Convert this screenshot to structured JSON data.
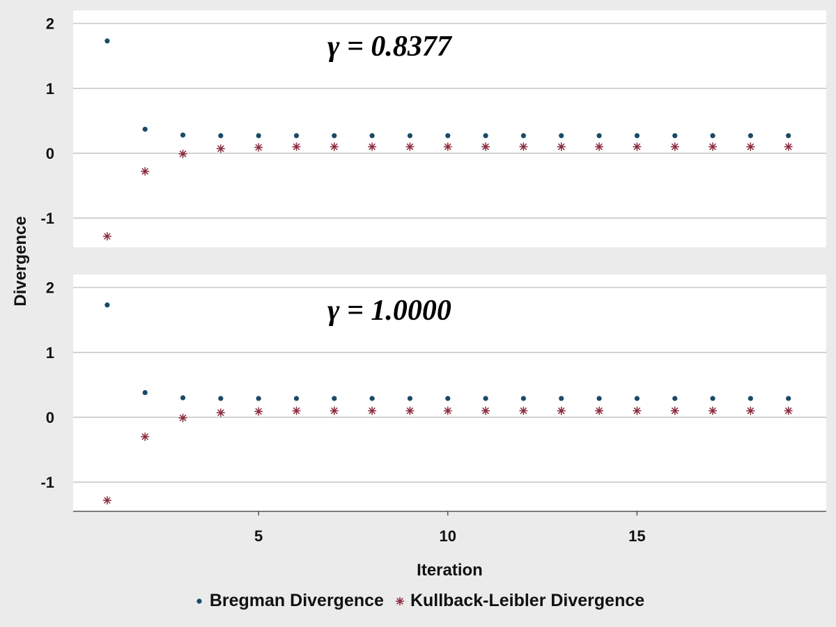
{
  "chart_data": {
    "type": "scatter",
    "xlabel": "Iteration",
    "ylabel": "Divergence",
    "xlim": [
      0.1,
      20.0
    ],
    "ylim": [
      -1.45,
      2.2
    ],
    "x_ticks": [
      5,
      10,
      15
    ],
    "y_ticks": [
      -1,
      0,
      1,
      2
    ],
    "grid": true,
    "legend_position": "bottom",
    "colors": {
      "bregman": "#1b4a66",
      "kl": "#8b2a3a",
      "panel_bg": "#ffffff",
      "outer_bg": "#ebebeb",
      "grid": "#c8c8c8"
    },
    "series_meta": [
      {
        "key": "bregman",
        "name": "Bregman Divergence",
        "marker": "dot"
      },
      {
        "key": "kl",
        "name": "Kullback-Leibler Divergence",
        "marker": "asterisk"
      }
    ],
    "panels": [
      {
        "label": "γ = 0.8377",
        "x": [
          1,
          2,
          3,
          4,
          5,
          6,
          7,
          8,
          9,
          10,
          11,
          12,
          13,
          14,
          15,
          16,
          17,
          18,
          19
        ],
        "bregman": [
          1.73,
          0.37,
          0.28,
          0.27,
          0.27,
          0.27,
          0.27,
          0.27,
          0.27,
          0.27,
          0.27,
          0.27,
          0.27,
          0.27,
          0.27,
          0.27,
          0.27,
          0.27,
          0.27
        ],
        "kl": [
          -1.28,
          -0.28,
          -0.01,
          0.07,
          0.09,
          0.1,
          0.1,
          0.1,
          0.1,
          0.1,
          0.1,
          0.1,
          0.1,
          0.1,
          0.1,
          0.1,
          0.1,
          0.1,
          0.1
        ]
      },
      {
        "label": "γ = 1.0000",
        "x": [
          1,
          2,
          3,
          4,
          5,
          6,
          7,
          8,
          9,
          10,
          11,
          12,
          13,
          14,
          15,
          16,
          17,
          18,
          19
        ],
        "bregman": [
          1.73,
          0.38,
          0.3,
          0.29,
          0.29,
          0.29,
          0.29,
          0.29,
          0.29,
          0.29,
          0.29,
          0.29,
          0.29,
          0.29,
          0.29,
          0.29,
          0.29,
          0.29,
          0.29
        ],
        "kl": [
          -1.28,
          -0.3,
          -0.01,
          0.07,
          0.09,
          0.1,
          0.1,
          0.1,
          0.1,
          0.1,
          0.1,
          0.1,
          0.1,
          0.1,
          0.1,
          0.1,
          0.1,
          0.1,
          0.1
        ]
      }
    ]
  }
}
